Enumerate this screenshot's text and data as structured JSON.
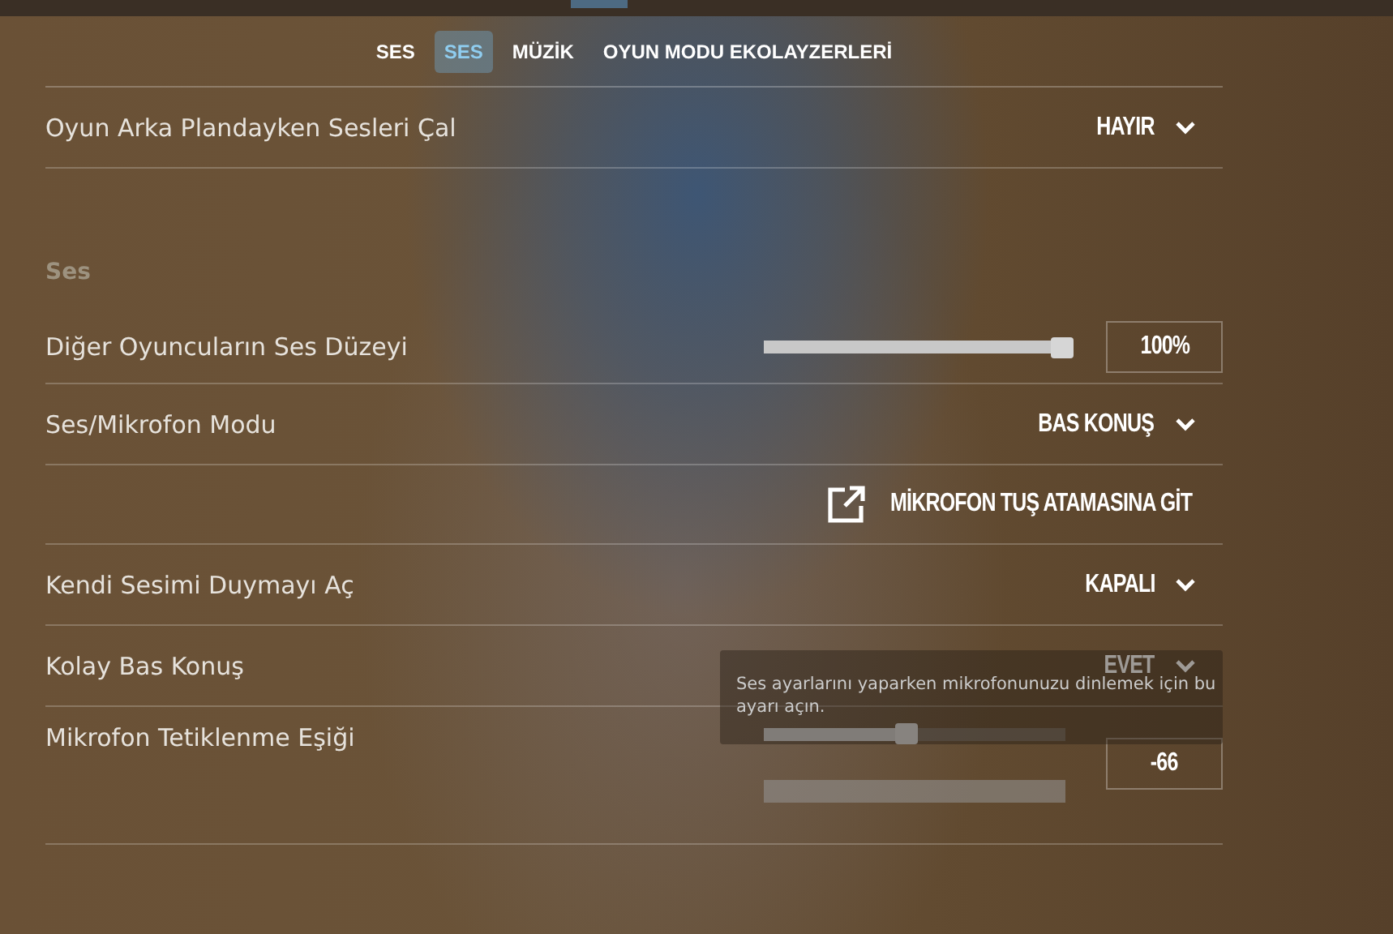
{
  "tabs": [
    {
      "label": "SES",
      "selected": false
    },
    {
      "label": "SES",
      "selected": true
    },
    {
      "label": "MÜZİK",
      "selected": false
    },
    {
      "label": "OYUN MODU EKOLAYZERLERİ",
      "selected": false
    }
  ],
  "sections": [
    {
      "rows": [
        {
          "kind": "dropdown",
          "label": "Oyun Arka Plandayken Sesleri Çal",
          "value": "HAYIR"
        }
      ]
    },
    {
      "title": "Ses",
      "rows": [
        {
          "kind": "slider",
          "label": "Diğer Oyuncuların Ses Düzeyi",
          "level": 0.99,
          "value": "100%"
        },
        {
          "kind": "dropdown",
          "label": "Ses/Mikrofon Modu",
          "value": "BAS KONUŞ"
        },
        {
          "kind": "link",
          "value": "MİKROFON TUŞ ATAMASINA GİT"
        },
        {
          "kind": "dropdown",
          "label": "Kendi Sesimi Duymayı Aç",
          "value": "KAPALI"
        },
        {
          "kind": "dropdown",
          "label": "Kolay Bas Konuş",
          "value": "EVET"
        },
        {
          "kind": "slider",
          "label": "Mikrofon Tetiklenme Eşiği",
          "level": 0.45,
          "value": "-66",
          "meter": true
        }
      ]
    }
  ],
  "tooltip": {
    "text": "Ses ayarlarını yaparken mikrofonunuzu dinlemek için bu ayarı açın."
  }
}
